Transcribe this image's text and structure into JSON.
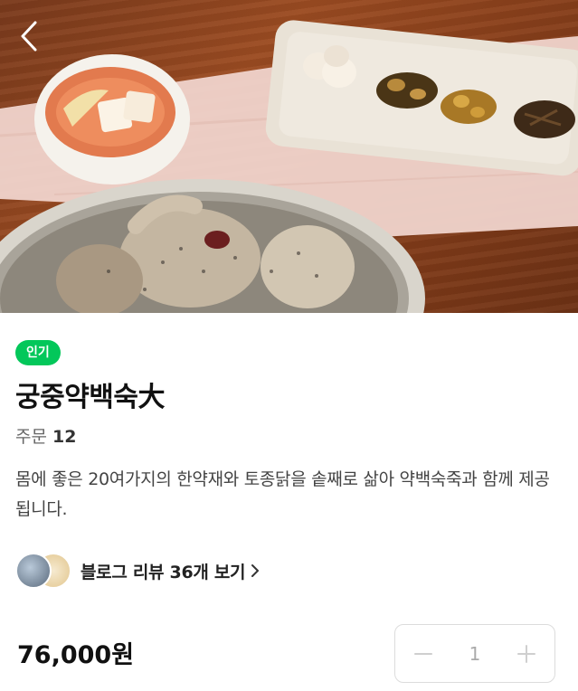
{
  "product": {
    "badge": "인기",
    "title": "궁중약백숙大",
    "order_label": "주문",
    "order_count": "12",
    "description": "몸에 좋은 20여가지의 한약재와 토종닭을 솥째로 삶아 약백숙죽과 함께 제공됩니다.",
    "price": "76,000원",
    "quantity": "1"
  },
  "blog": {
    "label": "블로그 리뷰 36개 보기"
  },
  "icons": {
    "back": "chevron-left-icon",
    "blog_more": "chevron-right-icon",
    "minus": "minus-icon",
    "plus": "plus-icon"
  },
  "colors": {
    "accent": "#03c75a",
    "text": "#222222",
    "muted": "#666666"
  }
}
